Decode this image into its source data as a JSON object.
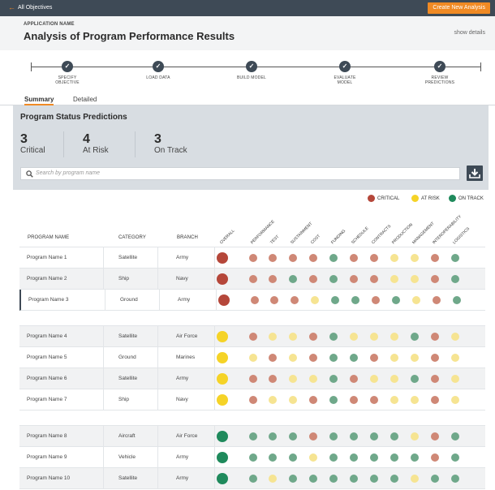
{
  "topbar": {
    "back_label": "All Objectives",
    "create_label": "Create New Analysis"
  },
  "header": {
    "app_name": "APPLICATION NAME",
    "title": "Analysis of Program Performance Results",
    "show_details": "show details"
  },
  "steps": [
    {
      "label_line1": "SPECIFY",
      "label_line2": "OBJECTIVE"
    },
    {
      "label_line1": "LOAD DATA",
      "label_line2": ""
    },
    {
      "label_line1": "BUILD MODEL",
      "label_line2": ""
    },
    {
      "label_line1": "EVALUATE",
      "label_line2": "MODEL"
    },
    {
      "label_line1": "REVIEW",
      "label_line2": "PREDICTIONS"
    }
  ],
  "tabs": [
    {
      "label": "Summary",
      "active": true
    },
    {
      "label": "Detailed",
      "active": false
    }
  ],
  "panel": {
    "title": "Program Status Predictions",
    "stats": [
      {
        "value": "3",
        "label": "Critical"
      },
      {
        "value": "4",
        "label": "At Risk"
      },
      {
        "value": "3",
        "label": "On Track"
      }
    ],
    "search_placeholder": "Search by program name"
  },
  "legend": [
    {
      "label": "CRITICAL",
      "color": "#b5473a"
    },
    {
      "label": "AT RISK",
      "color": "#f5d327"
    },
    {
      "label": "ON TRACK",
      "color": "#1f8a5c"
    }
  ],
  "colors": {
    "critical_big": "#b5473a",
    "atrisk_big": "#f5d327",
    "ontrack_big": "#1f8a5c",
    "critical": "#cf8876",
    "atrisk": "#f6e492",
    "ontrack": "#6fa88a",
    "accent": "#f08a24",
    "dark": "#3e4a56"
  },
  "table": {
    "col_program": "PROGRAM NAME",
    "col_category": "CATEGORY",
    "col_branch": "BRANCH",
    "metrics": [
      "OVERALL",
      "PERFORMANCE",
      "TEST",
      "SUSTAINMENT",
      "COST",
      "FUNDING",
      "SCHEDULE",
      "CONTRACTS",
      "PRODUCTION",
      "MANAGEMENT",
      "INTEROPERABILITY",
      "LOGISTICS"
    ],
    "rows": [
      {
        "name": "Program Name 1",
        "category": "Satellite",
        "branch": "Army",
        "overall": "critical",
        "metrics": [
          "critical",
          "critical",
          "critical",
          "critical",
          "ontrack",
          "critical",
          "critical",
          "atrisk",
          "atrisk",
          "critical",
          "ontrack"
        ]
      },
      {
        "name": "Program Name 2",
        "category": "Ship",
        "branch": "Navy",
        "overall": "critical",
        "metrics": [
          "critical",
          "critical",
          "ontrack",
          "critical",
          "ontrack",
          "critical",
          "critical",
          "atrisk",
          "atrisk",
          "critical",
          "ontrack"
        ]
      },
      {
        "name": "Program Name 3",
        "category": "Ground",
        "branch": "Army",
        "overall": "critical",
        "metrics": [
          "critical",
          "critical",
          "critical",
          "atrisk",
          "ontrack",
          "ontrack",
          "critical",
          "ontrack",
          "atrisk",
          "critical",
          "ontrack"
        ]
      },
      {
        "name": "Program Name 4",
        "category": "Satellite",
        "branch": "Air Force",
        "overall": "atrisk",
        "metrics": [
          "critical",
          "atrisk",
          "atrisk",
          "critical",
          "ontrack",
          "atrisk",
          "atrisk",
          "atrisk",
          "ontrack",
          "critical",
          "atrisk"
        ]
      },
      {
        "name": "Program Name 5",
        "category": "Ground",
        "branch": "Marines",
        "overall": "atrisk",
        "metrics": [
          "atrisk",
          "critical",
          "atrisk",
          "critical",
          "ontrack",
          "ontrack",
          "critical",
          "atrisk",
          "atrisk",
          "critical",
          "atrisk"
        ]
      },
      {
        "name": "Program Name 6",
        "category": "Satellite",
        "branch": "Army",
        "overall": "atrisk",
        "metrics": [
          "critical",
          "critical",
          "atrisk",
          "atrisk",
          "ontrack",
          "critical",
          "atrisk",
          "atrisk",
          "ontrack",
          "critical",
          "atrisk"
        ]
      },
      {
        "name": "Program Name 7",
        "category": "Ship",
        "branch": "Navy",
        "overall": "atrisk",
        "metrics": [
          "critical",
          "atrisk",
          "atrisk",
          "critical",
          "ontrack",
          "critical",
          "critical",
          "atrisk",
          "atrisk",
          "critical",
          "atrisk"
        ]
      },
      {
        "name": "Program Name 8",
        "category": "Aircraft",
        "branch": "Air Force",
        "overall": "ontrack",
        "metrics": [
          "ontrack",
          "ontrack",
          "ontrack",
          "critical",
          "ontrack",
          "ontrack",
          "ontrack",
          "ontrack",
          "atrisk",
          "critical",
          "ontrack"
        ]
      },
      {
        "name": "Program Name 9",
        "category": "Vehicle",
        "branch": "Army",
        "overall": "ontrack",
        "metrics": [
          "ontrack",
          "ontrack",
          "ontrack",
          "atrisk",
          "ontrack",
          "ontrack",
          "ontrack",
          "ontrack",
          "ontrack",
          "critical",
          "ontrack"
        ]
      },
      {
        "name": "Program Name 10",
        "category": "Satellite",
        "branch": "Army",
        "overall": "ontrack",
        "metrics": [
          "ontrack",
          "atrisk",
          "ontrack",
          "ontrack",
          "ontrack",
          "ontrack",
          "ontrack",
          "ontrack",
          "atrisk",
          "ontrack",
          "ontrack"
        ]
      }
    ]
  }
}
